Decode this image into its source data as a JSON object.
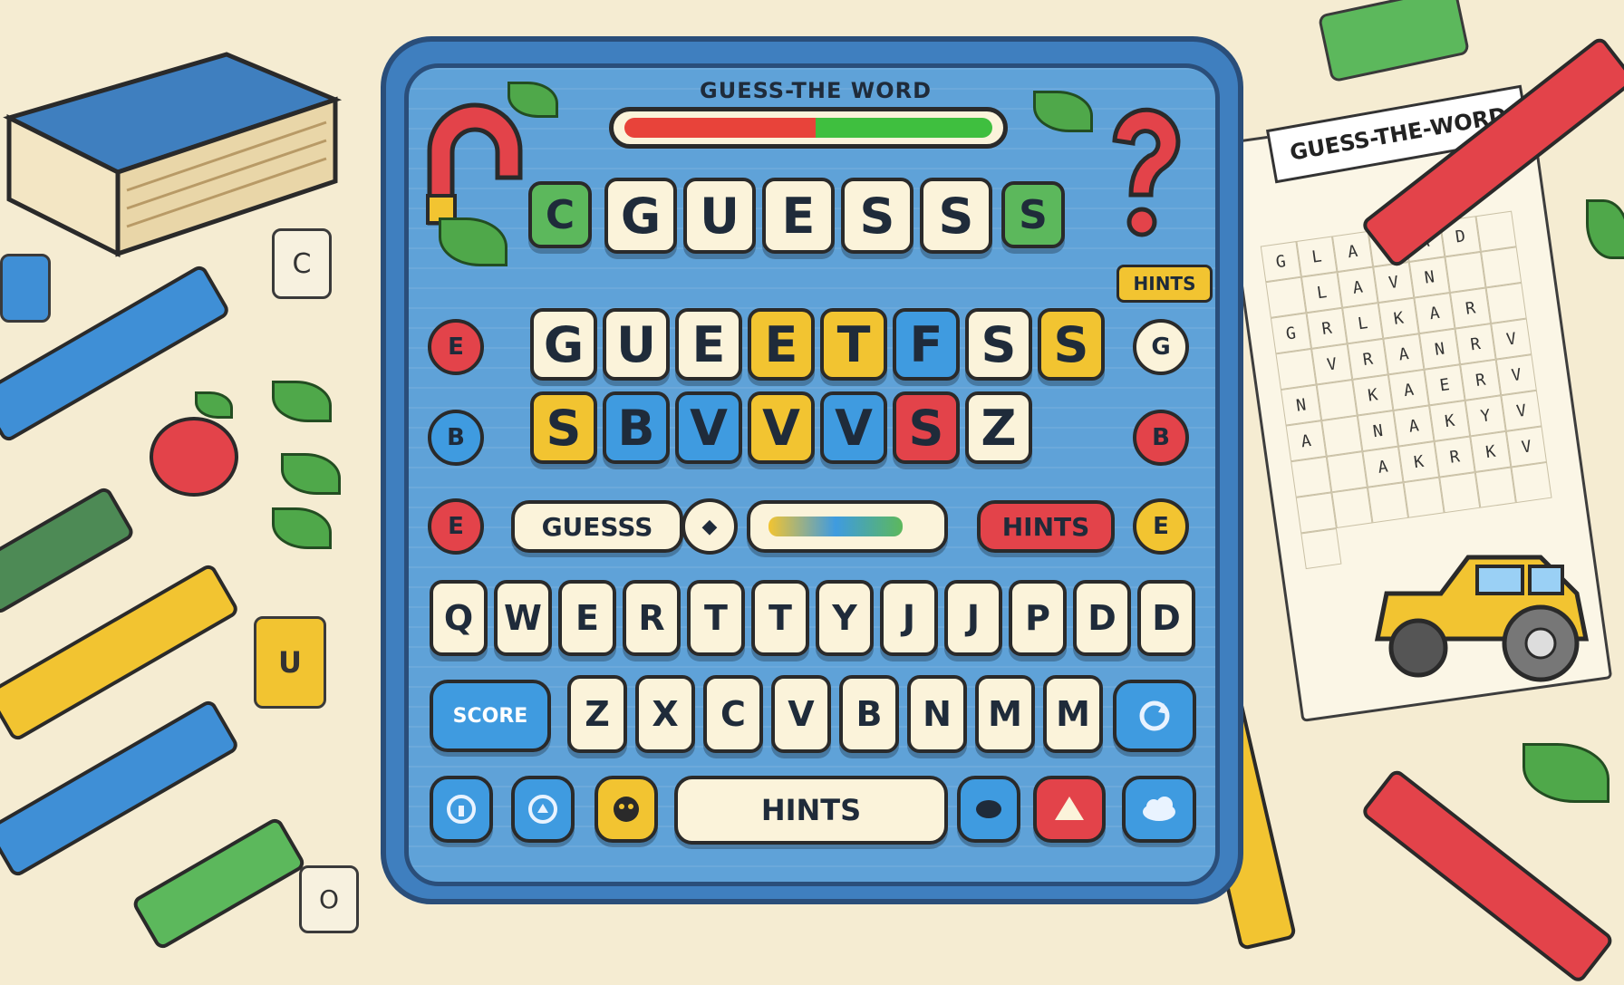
{
  "header": {
    "title": "GUESS-THE WORD",
    "progress": 0.52,
    "hints_badge": "HINTS"
  },
  "guess_row": {
    "letters": [
      "C",
      "G",
      "U",
      "E",
      "S",
      "S",
      "S"
    ]
  },
  "board": {
    "row1": [
      "G",
      "U",
      "E",
      "E",
      "T",
      "F",
      "S",
      "S"
    ],
    "row2": [
      "S",
      "B",
      "V",
      "V",
      "V",
      "S",
      "Z"
    ],
    "side_left": [
      "E",
      "B",
      "E"
    ],
    "side_right": [
      "G",
      "B",
      "E"
    ]
  },
  "controls": {
    "guess_label": "GUESSS",
    "guess_icon": "◆",
    "hints_label": "HINTS"
  },
  "keyboard": {
    "row1": [
      "Q",
      "W",
      "E",
      "R",
      "T",
      "T",
      "Y",
      "J",
      "J",
      "P",
      "D",
      "D"
    ],
    "row2": [
      "Z",
      "X",
      "C",
      "V",
      "B",
      "N",
      "M",
      "M"
    ],
    "score_label": "SCORE",
    "hints_label": "HINTS"
  },
  "background": {
    "sheet_title": "GUESS-THE-WORD",
    "puzzle_left": "C",
    "puzzle_bottom": "U",
    "puzzle_corner": "O",
    "sheet_grid": [
      "G",
      "L",
      "A",
      "N",
      "A",
      "D",
      "",
      "",
      "L",
      "A",
      "V",
      "N",
      "",
      "",
      "G",
      "R",
      "L",
      "K",
      "A",
      "R",
      "",
      "",
      "V",
      "R",
      "A",
      "N",
      "R",
      "V",
      "N",
      "",
      "K",
      "A",
      "E",
      "R",
      "V",
      "A",
      "",
      "N",
      "A",
      "K",
      "Y",
      "V",
      "",
      "",
      "A",
      "K",
      "R",
      "K",
      "V",
      "",
      "",
      "",
      "",
      "",
      "",
      "",
      ""
    ]
  },
  "colors": {
    "panel": "#3f7fbf",
    "tile": "#fbf3da",
    "yellow": "#f2c431",
    "blue": "#3f9be0",
    "red": "#e3434a",
    "green": "#5cb85c"
  }
}
